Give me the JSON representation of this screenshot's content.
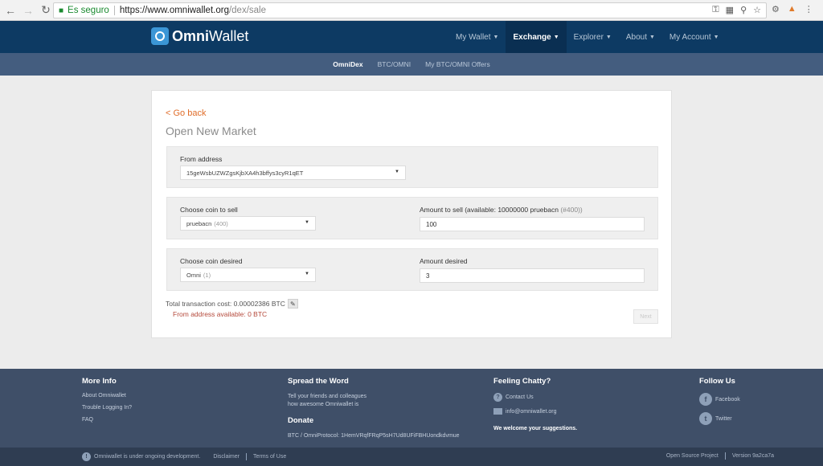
{
  "browser": {
    "secure_label": "Es seguro",
    "url_host": "https://www.omniwallet.org",
    "url_path": "/dex/sale"
  },
  "nav": {
    "brand_bold": "Omni",
    "brand_rest": "Wallet",
    "items": [
      {
        "label": "My Wallet",
        "active": false
      },
      {
        "label": "Exchange",
        "active": true
      },
      {
        "label": "Explorer",
        "active": false
      },
      {
        "label": "About",
        "active": false
      },
      {
        "label": "My Account",
        "active": false
      }
    ]
  },
  "subnav": {
    "items": [
      {
        "label": "OmniDex",
        "active": true
      },
      {
        "label": "BTC/OMNI",
        "active": false
      },
      {
        "label": "My BTC/OMNI Offers",
        "active": false
      }
    ]
  },
  "form": {
    "go_back": "< Go back",
    "title": "Open New Market",
    "from_address_label": "From address",
    "from_address_value": "15geWsbUZWZgsKjbXA4h3bffys3cyR1qET",
    "coin_sell_label": "Choose coin to sell",
    "coin_sell_value": "pruebacn",
    "coin_sell_id": "(400)",
    "amount_sell_label": "Amount to sell (available: 10000000 pruebacn",
    "amount_sell_id": "(#400))",
    "amount_sell_value": "100",
    "coin_desired_label": "Choose coin desired",
    "coin_desired_value": "Omni",
    "coin_desired_id": "(1)",
    "amount_desired_label": "Amount desired",
    "amount_desired_value": "3",
    "tx_cost": "Total transaction cost: 0.00002386 BTC",
    "available": "From address available: 0 BTC",
    "next_label": "Next"
  },
  "footer": {
    "more_info": {
      "title": "More Info",
      "links": [
        "About Omniwallet",
        "Trouble Logging In?",
        "FAQ"
      ]
    },
    "spread": {
      "title": "Spread the Word",
      "line1": "Tell your friends and colleagues",
      "line2": "how awesome Omniwallet is",
      "donate_title": "Donate",
      "donate_text": "BTC / OmniProtocol: 1HemVRqfFRqP5sH7Ud8UFiFBHUondkdvmue"
    },
    "chatty": {
      "title": "Feeling Chatty?",
      "contact": "Contact Us",
      "email": "info@omniwallet.org",
      "welcome": "We welcome your suggestions."
    },
    "follow": {
      "title": "Follow Us",
      "facebook": "Facebook",
      "twitter": "Twitter"
    }
  },
  "bottom": {
    "notice": "Omniwallet is under ongoing development.",
    "disclaimer": "Disclaimer",
    "terms": "Terms of Use",
    "open_source": "Open Source Project",
    "version": "Version 9a2ca7a"
  }
}
